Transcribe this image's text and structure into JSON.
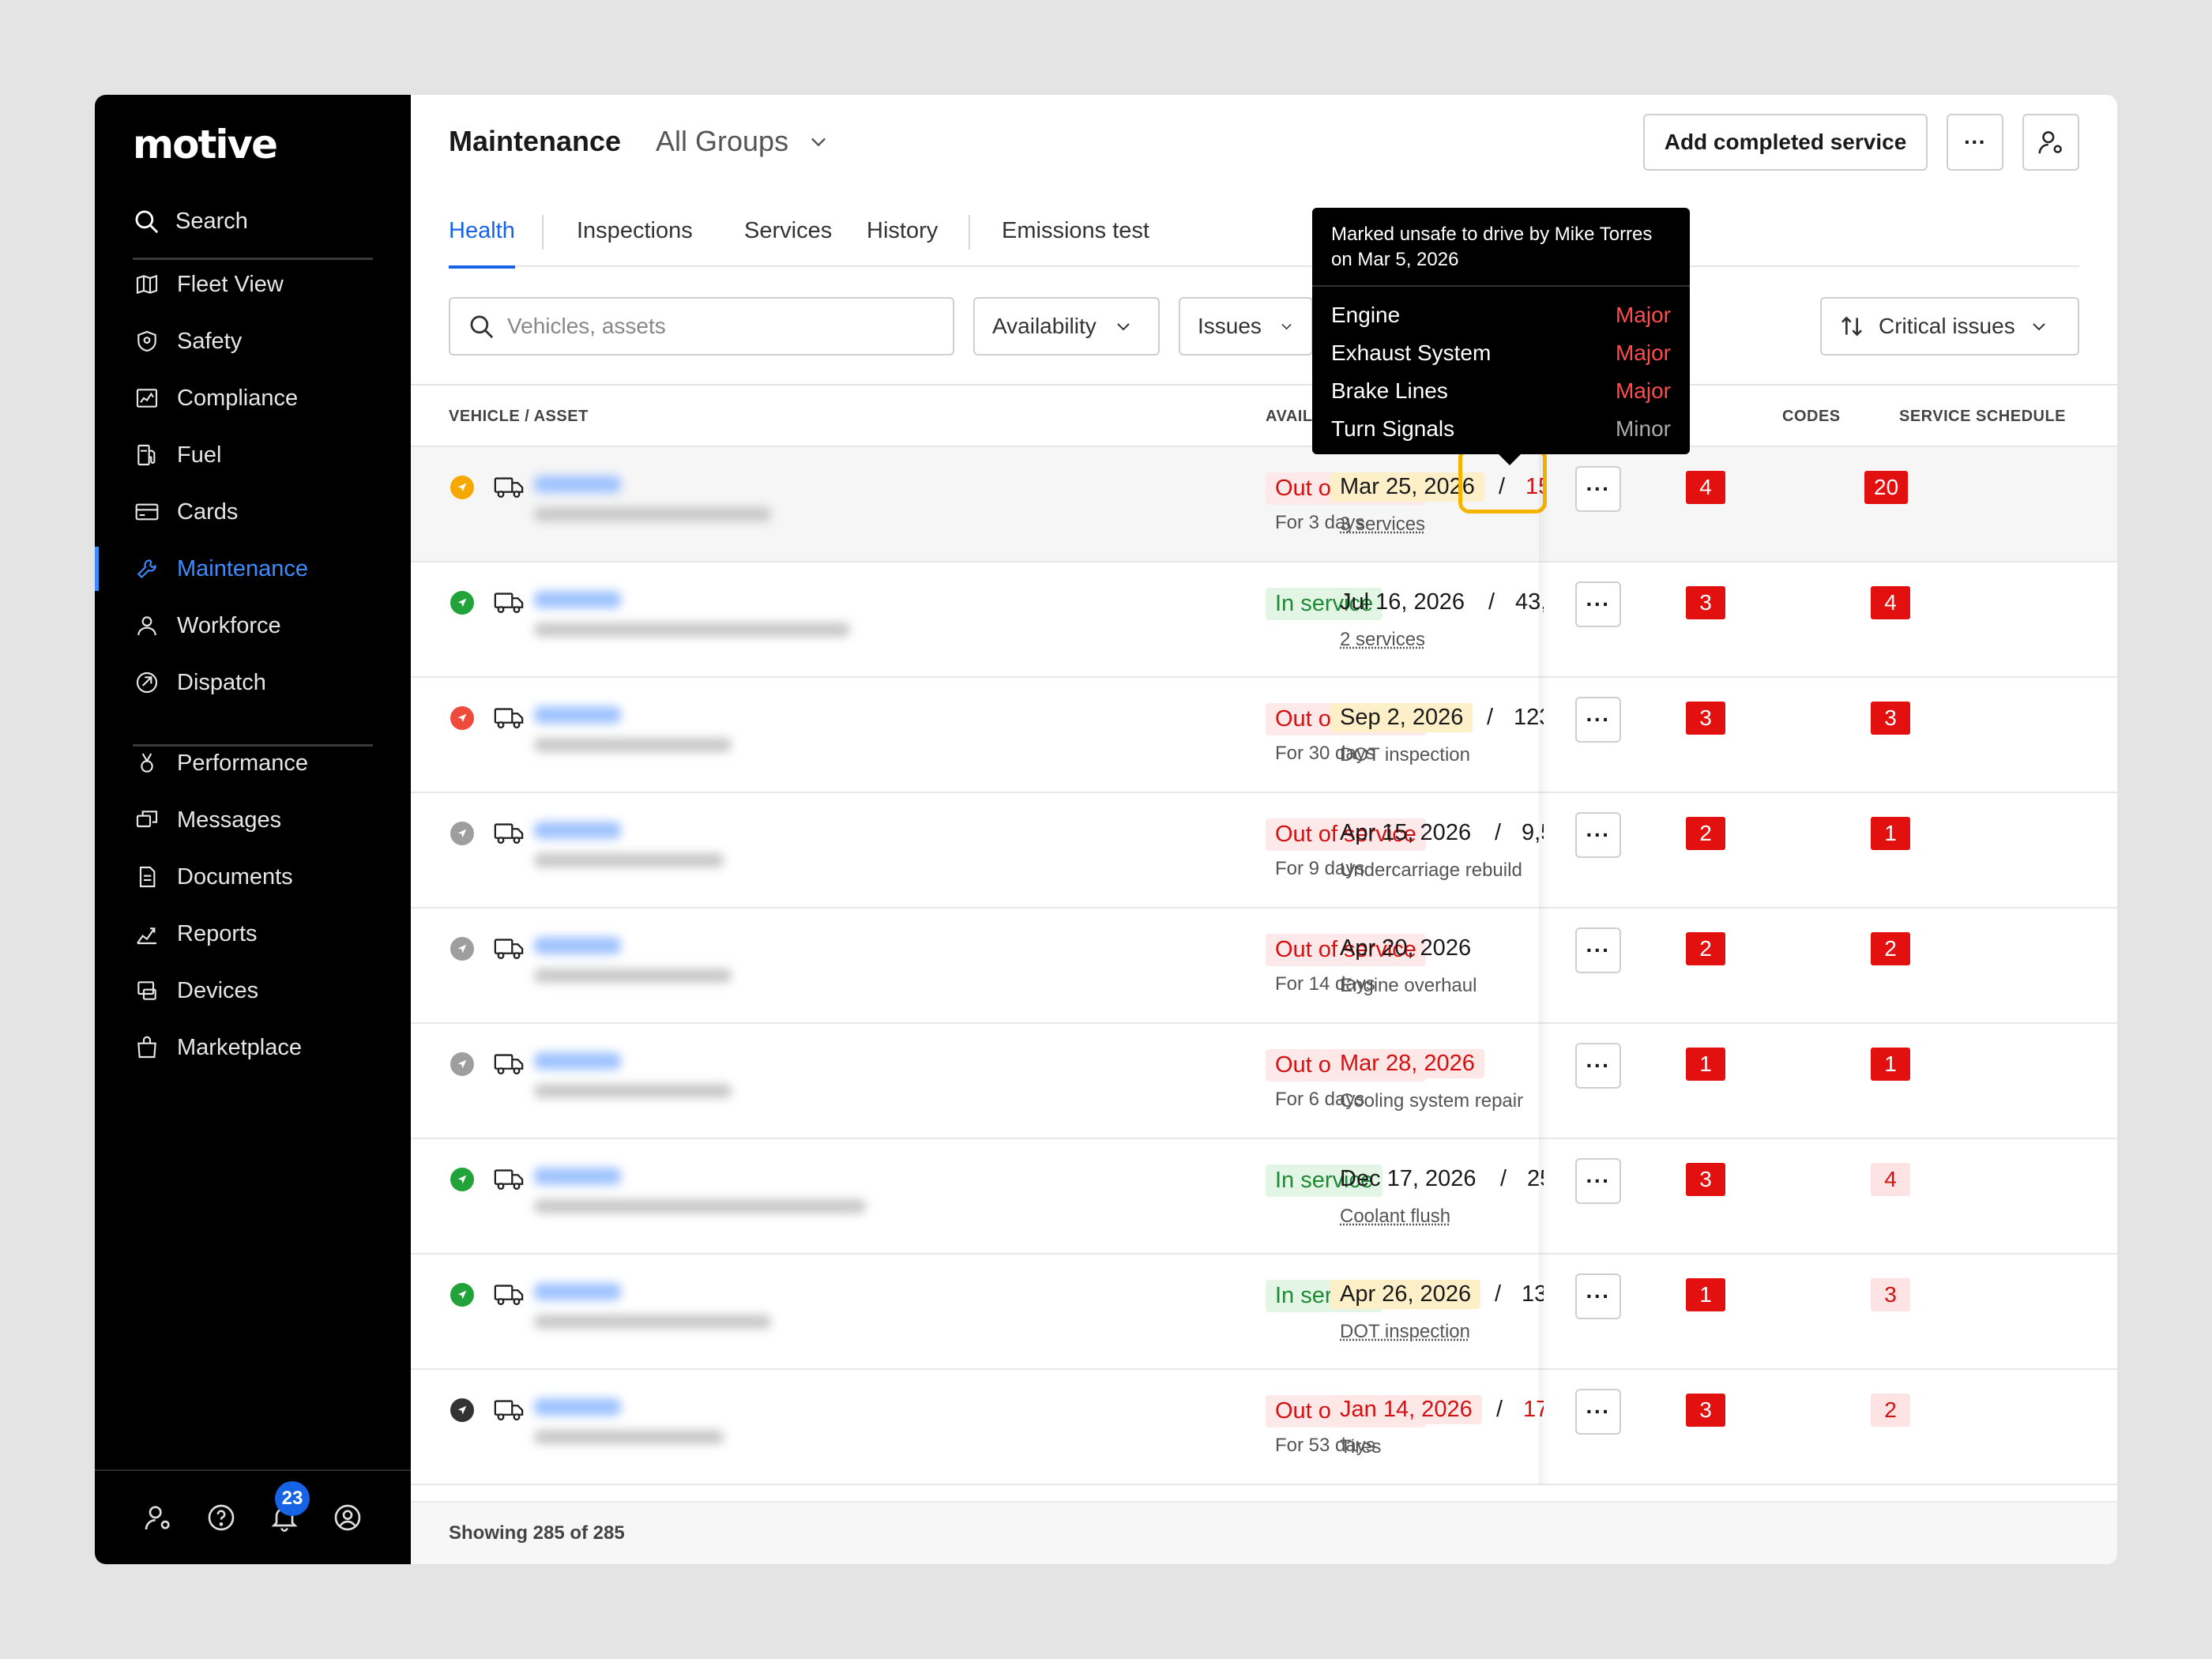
{
  "brand": {
    "logo": "motive"
  },
  "sidebar": {
    "search_label": "Search",
    "items": [
      {
        "label": "Fleet View",
        "icon": "map-icon"
      },
      {
        "label": "Safety",
        "icon": "shield-icon"
      },
      {
        "label": "Compliance",
        "icon": "compliance-icon"
      },
      {
        "label": "Fuel",
        "icon": "fuel-icon"
      },
      {
        "label": "Cards",
        "icon": "card-icon"
      },
      {
        "label": "Maintenance",
        "icon": "wrench-icon",
        "active": true
      },
      {
        "label": "Workforce",
        "icon": "person-icon"
      },
      {
        "label": "Dispatch",
        "icon": "dispatch-icon"
      },
      {
        "label": "Performance",
        "icon": "medal-icon"
      },
      {
        "label": "Messages",
        "icon": "messages-icon"
      },
      {
        "label": "Documents",
        "icon": "document-icon"
      },
      {
        "label": "Reports",
        "icon": "reports-icon"
      },
      {
        "label": "Devices",
        "icon": "devices-icon"
      },
      {
        "label": "Marketplace",
        "icon": "bag-icon"
      }
    ],
    "notification_count": "23"
  },
  "header": {
    "title": "Maintenance",
    "group": "All Groups",
    "add_service_label": "Add completed service",
    "more_label": "···"
  },
  "tabs": [
    "Health",
    "Inspections",
    "Services",
    "History",
    "Emissions test"
  ],
  "filters": {
    "search_placeholder": "Vehicles, assets",
    "availability": "Availability",
    "issues": "Issues",
    "sort": "Critical issues"
  },
  "table": {
    "columns": {
      "vehicle": "VEHICLE / ASSET",
      "availability": "AVAILABILITY",
      "codes": "CODES",
      "schedule": "SERVICE SCHEDULE"
    },
    "rows": [
      {
        "status": "yellow",
        "avail": "Out of service",
        "avail_state": "out",
        "avail_sub": "For 3 days",
        "issues": "4",
        "codes": "20",
        "codes_style": "solid",
        "date": "Mar 25, 2026",
        "date_style": "yellow",
        "miles": "15",
        "miles_red": true,
        "sub": "3 services",
        "sub_link": true
      },
      {
        "status": "green",
        "avail": "In service",
        "avail_state": "in",
        "avail_sub": "",
        "issues": "3",
        "codes": "4",
        "codes_style": "solid",
        "date": "Jul 16, 2026",
        "date_style": "plain",
        "miles": "43,",
        "miles_red": false,
        "sub": "2 services",
        "sub_link": true
      },
      {
        "status": "red",
        "avail": "Out of service",
        "avail_state": "out",
        "avail_sub": "For 30 days",
        "issues": "3",
        "codes": "3",
        "codes_style": "solid",
        "date": "Sep 2, 2026",
        "date_style": "yellow",
        "miles": "123",
        "miles_red": false,
        "sub": "DOT inspection",
        "sub_link": false
      },
      {
        "status": "gray",
        "avail": "Out of service",
        "avail_state": "out",
        "avail_sub": "For 9 days",
        "issues": "2",
        "codes": "1",
        "codes_style": "solid",
        "date": "Apr 15, 2026",
        "date_style": "plain",
        "miles": "9,5",
        "miles_red": false,
        "sub": "Undercarriage rebuild",
        "sub_link": false
      },
      {
        "status": "gray",
        "avail": "Out of service",
        "avail_state": "out",
        "avail_sub": "For 14 days",
        "issues": "2",
        "codes": "2",
        "codes_style": "solid",
        "date": "Apr 20, 2026",
        "date_style": "plain",
        "miles": "",
        "miles_red": false,
        "sub": "Engine overhaul",
        "sub_link": false
      },
      {
        "status": "gray",
        "avail": "Out of service",
        "avail_state": "out",
        "avail_sub": "For 6 days",
        "issues": "1",
        "codes": "1",
        "codes_style": "solid",
        "date": "Mar 28, 2026",
        "date_style": "red",
        "miles": "",
        "miles_red": false,
        "sub": "Cooling system repair",
        "sub_link": false
      },
      {
        "status": "green",
        "avail": "In service",
        "avail_state": "in",
        "avail_sub": "",
        "issues": "3",
        "codes": "4",
        "codes_style": "soft",
        "date": "Dec 17, 2026",
        "date_style": "plain",
        "miles": "25",
        "miles_red": false,
        "sub": "Coolant flush",
        "sub_link": true
      },
      {
        "status": "green",
        "avail": "In service",
        "avail_state": "in",
        "avail_sub": "",
        "issues": "1",
        "codes": "3",
        "codes_style": "soft",
        "date": "Apr 26, 2026",
        "date_style": "yellow",
        "miles": "13",
        "miles_red": false,
        "sub": "DOT inspection",
        "sub_link": true
      },
      {
        "status": "dark",
        "avail": "Out of service",
        "avail_state": "out",
        "avail_sub": "For 53 days",
        "issues": "3",
        "codes": "2",
        "codes_style": "soft",
        "date": "Jan 14, 2026",
        "date_style": "red",
        "miles": "17",
        "miles_red": true,
        "sub": "Tires",
        "sub_link": false
      }
    ],
    "footer": "Showing 285 of 285"
  },
  "tooltip": {
    "header": "Marked unsafe to drive by Mike Torres on Mar 5, 2026",
    "items": [
      {
        "name": "Engine",
        "severity": "Major"
      },
      {
        "name": "Exhaust System",
        "severity": "Major"
      },
      {
        "name": "Brake Lines",
        "severity": "Major"
      },
      {
        "name": "Turn Signals",
        "severity": "Minor"
      }
    ]
  },
  "colors": {
    "accent": "#1763e6",
    "danger": "#e31010",
    "success": "#1e8a35",
    "focus": "#f5b400",
    "status_yellow": "#f5a800",
    "status_green": "#22a33a",
    "status_red": "#ee4b3d",
    "status_gray": "#9e9e9e",
    "status_dark": "#333333"
  }
}
